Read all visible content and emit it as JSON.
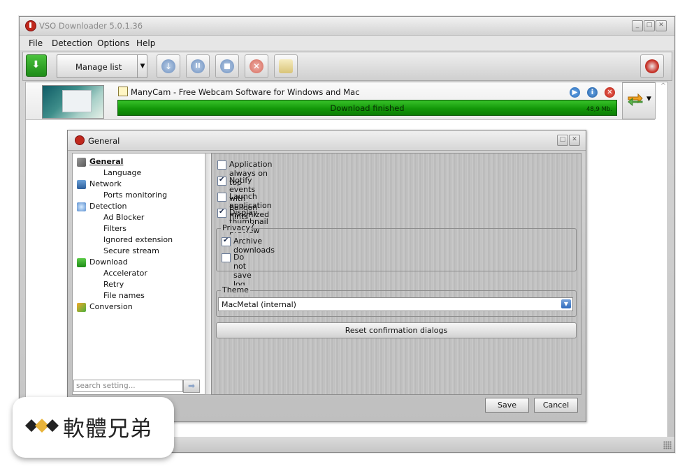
{
  "window": {
    "title": "VSO Downloader 5.0.1.36"
  },
  "menu": [
    "File",
    "Detection",
    "Options",
    "Help"
  ],
  "toolbar": {
    "manage_list": "Manage list"
  },
  "download": {
    "name": "ManyCam - Free Webcam Software for Windows and Mac",
    "status": "Download finished",
    "size": "48,9 Mb.",
    "progress": 1.0
  },
  "dialog": {
    "title": "General",
    "tree": [
      {
        "label": "General",
        "level": 0,
        "icon": "tools-icon",
        "selected": true
      },
      {
        "label": "Language",
        "level": 1
      },
      {
        "label": "Network",
        "level": 0,
        "icon": "network-icon"
      },
      {
        "label": "Ports monitoring",
        "level": 1
      },
      {
        "label": "Detection",
        "level": 0,
        "icon": "magnifier-icon"
      },
      {
        "label": "Ad Blocker",
        "level": 1
      },
      {
        "label": "Filters",
        "level": 1
      },
      {
        "label": "Ignored extension",
        "level": 1
      },
      {
        "label": "Secure stream",
        "level": 1
      },
      {
        "label": "Download",
        "level": 0,
        "icon": "download-icon"
      },
      {
        "label": "Accelerator",
        "level": 1
      },
      {
        "label": "Retry",
        "level": 1
      },
      {
        "label": "File names",
        "level": 1
      },
      {
        "label": "Conversion",
        "level": 0,
        "icon": "conversion-icon"
      }
    ],
    "search_placeholder": "search setting...",
    "options": {
      "always_on_top": {
        "label": "Application always on top",
        "checked": false
      },
      "balloon_hints": {
        "label": "Notify events with balloon hints in tray",
        "checked": true
      },
      "launch_minimized": {
        "label": "Launch application minimized",
        "checked": false
      },
      "thumbnail_preview": {
        "label": "Display thumbnail preview",
        "checked": true
      }
    },
    "privacy": {
      "title": "Privacy",
      "archive_downloads": {
        "label": "Archive downloads",
        "checked": true
      },
      "no_save_log": {
        "label": "Do not save log",
        "checked": false
      }
    },
    "theme": {
      "title": "Theme",
      "value": "MacMetal (internal)"
    },
    "reset_label": "Reset confirmation dialogs",
    "save_label": "Save",
    "cancel_label": "Cancel"
  },
  "watermark": {
    "text": "軟體兄弟"
  }
}
